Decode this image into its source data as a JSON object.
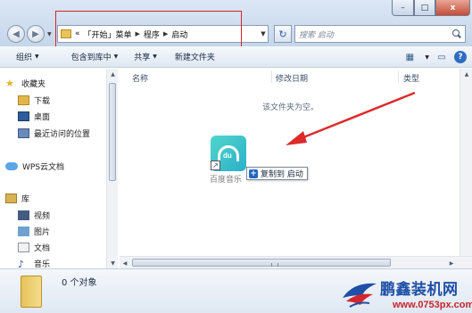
{
  "window": {
    "min_label": "–",
    "max_label": "□",
    "close_label": "x"
  },
  "address": {
    "lead": "«",
    "segments": [
      "「开始」菜单",
      "程序",
      "启动"
    ],
    "search_placeholder": "搜索 启动"
  },
  "toolbar": {
    "items": [
      "组织",
      "包含到库中",
      "共享",
      "新建文件夹"
    ]
  },
  "sidebar": {
    "favorites_label": "收藏夹",
    "favorites": [
      "下载",
      "桌面",
      "最近访问的位置"
    ],
    "wps_label": "WPS云文档",
    "library_label": "库",
    "library": [
      "视频",
      "图片",
      "文档",
      "音乐"
    ]
  },
  "columns": [
    "名称",
    "修改日期",
    "类型"
  ],
  "empty_message": "该文件夹为空。",
  "drag": {
    "app_name": "百度音乐",
    "tip": "复制到 启动"
  },
  "details": {
    "count": "0 个对象"
  },
  "watermark": {
    "title": "鹏鑫装机网",
    "url": "www.0753px.com"
  }
}
